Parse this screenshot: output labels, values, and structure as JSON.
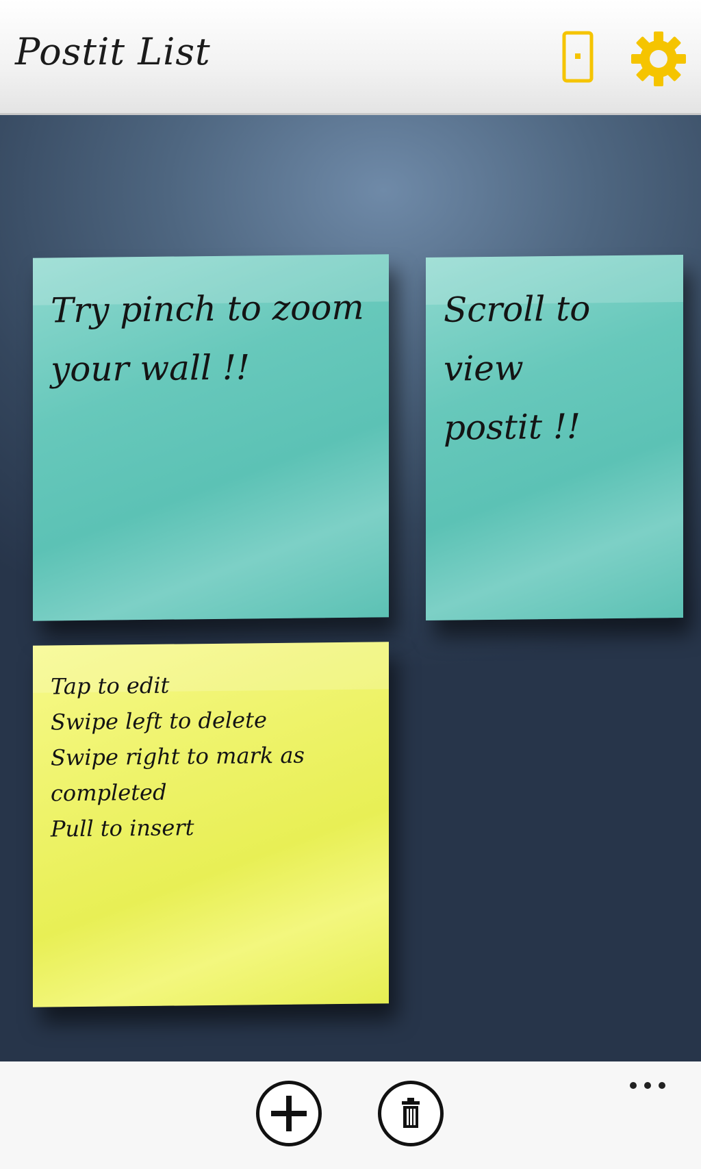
{
  "header": {
    "title": "Postit List",
    "icons": [
      "phone-icon",
      "gear-icon"
    ],
    "accent_color": "#f5c400"
  },
  "notes": [
    {
      "color": "#66c8bb",
      "text": "Try pinch to zoom\nyour wall !!"
    },
    {
      "color": "#66c8bb",
      "text": "Scroll to view\npostit !!"
    },
    {
      "color": "#ecf25e",
      "text": "Tap to edit\nSwipe left to delete\nSwipe right to mark as\ncompleted\nPull to insert"
    }
  ],
  "appbar": {
    "icons": [
      "add-icon",
      "delete-icon",
      "more-icon"
    ]
  }
}
